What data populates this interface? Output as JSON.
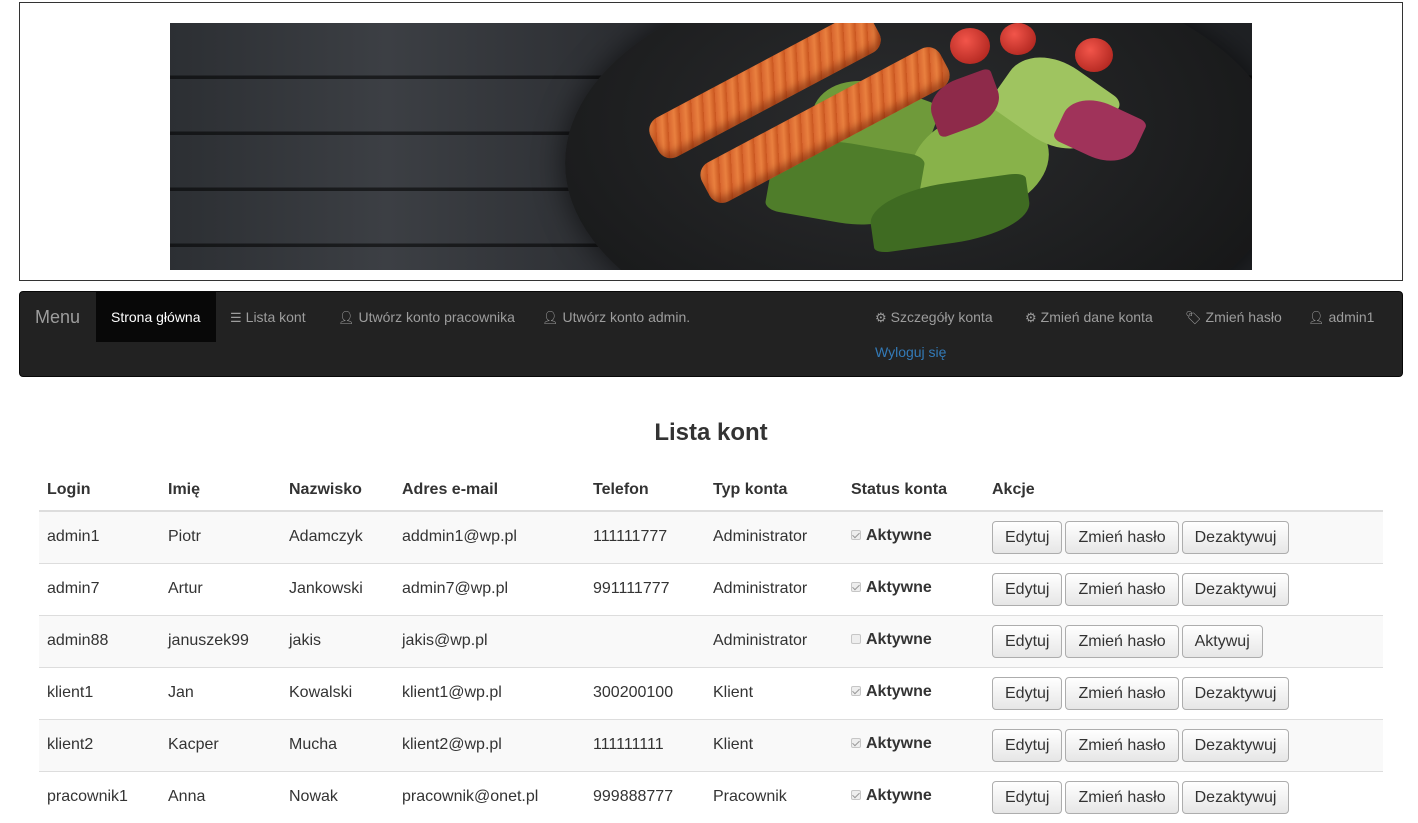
{
  "banner": {
    "icon": "salmon-salad-banner-image"
  },
  "navbar": {
    "brand": "Menu",
    "items": [
      {
        "label": "Strona główna",
        "icon": ""
      },
      {
        "label": "Lista kont",
        "icon": "list-icon"
      },
      {
        "label": "Utwórz konto pracownika",
        "icon": "user-icon"
      },
      {
        "label": "Utwórz konto admin.",
        "icon": "user-icon"
      }
    ],
    "right_items": [
      {
        "label": "Szczegóły konta",
        "icon": "gear-icon"
      },
      {
        "label": "Zmień dane konta",
        "icon": "gear-icon"
      },
      {
        "label": "Zmień hasło",
        "icon": "tags-icon"
      },
      {
        "label": "admin1",
        "icon": "user-icon"
      }
    ],
    "logout": "Wyloguj się"
  },
  "main": {
    "title": "Lista kont",
    "columns": [
      "Login",
      "Imię",
      "Nazwisko",
      "Adres e-mail",
      "Telefon",
      "Typ konta",
      "Status konta",
      "Akcje"
    ],
    "status_label": "Aktywne",
    "buttons": {
      "edit": "Edytuj",
      "change_password": "Zmień hasło",
      "deactivate": "Dezaktywuj",
      "activate": "Aktywuj"
    },
    "rows": [
      {
        "login": "admin1",
        "first": "Piotr",
        "last": "Adamczyk",
        "email": "addmin1@wp.pl",
        "phone": "111111777",
        "type": "Administrator",
        "active": true,
        "toggle": "Dezaktywuj"
      },
      {
        "login": "admin7",
        "first": "Artur",
        "last": "Jankowski",
        "email": "admin7@wp.pl",
        "phone": "991111777",
        "type": "Administrator",
        "active": true,
        "toggle": "Dezaktywuj"
      },
      {
        "login": "admin88",
        "first": "januszek99",
        "last": "jakis",
        "email": "jakis@wp.pl",
        "phone": "",
        "type": "Administrator",
        "active": false,
        "toggle": "Aktywuj"
      },
      {
        "login": "klient1",
        "first": "Jan",
        "last": "Kowalski",
        "email": "klient1@wp.pl",
        "phone": "300200100",
        "type": "Klient",
        "active": true,
        "toggle": "Dezaktywuj"
      },
      {
        "login": "klient2",
        "first": "Kacper",
        "last": "Mucha",
        "email": "klient2@wp.pl",
        "phone": "111111111",
        "type": "Klient",
        "active": true,
        "toggle": "Dezaktywuj"
      },
      {
        "login": "pracownik1",
        "first": "Anna",
        "last": "Nowak",
        "email": "pracownik@onet.pl",
        "phone": "999888777",
        "type": "Pracownik",
        "active": true,
        "toggle": "Dezaktywuj"
      }
    ]
  }
}
